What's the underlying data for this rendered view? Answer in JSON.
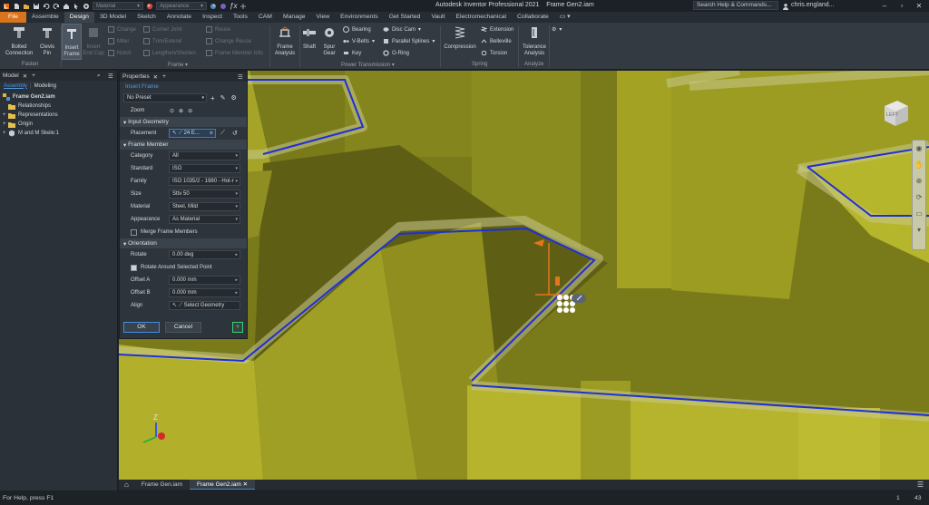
{
  "titlebar": {
    "material_placeholder": "Material",
    "appearance_placeholder": "Appearance",
    "app_title": "Autodesk Inventor Professional 2021",
    "doc_title": "Frame Gen2.iam",
    "search_placeholder": "Search Help & Commands...",
    "user": "chris.england..."
  },
  "menu": {
    "tabs": [
      "File",
      "Assemble",
      "Design",
      "3D Model",
      "Sketch",
      "Annotate",
      "Inspect",
      "Tools",
      "CAM",
      "Manage",
      "View",
      "Environments",
      "Get Started",
      "Vault",
      "Electromechanical",
      "Collaborate"
    ],
    "active": "Design"
  },
  "ribbon": {
    "fasten": {
      "bolted": "Bolted Connection",
      "bolted_1": "Bolted",
      "bolted_2": "Connection",
      "clevis_1": "Clevis",
      "clevis_2": "Pin",
      "label": "Fasten"
    },
    "frame": {
      "insert_1": "Insert",
      "insert_2": "Frame",
      "endcap_1": "Insert",
      "endcap_2": "End Cap",
      "change": "Change",
      "miter": "Miter",
      "notch": "Notch",
      "corner_joint": "Corner Joint",
      "trim_extend": "Trim/Extend",
      "lengthen": "Lengthen/Shorten",
      "reuse": "Reuse",
      "change_reuse": "Change Reuse",
      "member_info": "Frame Member Info",
      "label": "Frame"
    },
    "frame_analysis_1": "Frame",
    "frame_analysis_2": "Analysis",
    "power": {
      "shaft": "Shaft",
      "spur_1": "Spur",
      "spur_2": "Gear",
      "bearing": "Bearing",
      "vbelts": "V-Belts",
      "key": "Key",
      "disc_cam": "Disc Cam",
      "parallel_splines": "Parallel Splines",
      "oring": "O-Ring",
      "label": "Power Transmission"
    },
    "spring": {
      "compression": "Compression",
      "extension": "Extension",
      "belleville": "Belleville",
      "torsion": "Torsion",
      "label": "Spring"
    },
    "analyze": {
      "tol_1": "Tolerance",
      "tol_2": "Analysis",
      "label": "Analyze"
    }
  },
  "browser": {
    "title": "Model",
    "tab_assembly": "Assembly",
    "tab_modeling": "Modeling",
    "root": "Frame Gen2.iam",
    "items": [
      "Relationships",
      "Representations",
      "Origin",
      "M and M Skele:1"
    ]
  },
  "properties": {
    "title": "Properties",
    "command": "Insert Frame",
    "preset": "No Preset",
    "zoom_label": "Zoom",
    "input_geometry": "Input Geometry",
    "placement_label": "Placement",
    "placement_value": "24 E...",
    "frame_member": "Frame Member",
    "fields": [
      {
        "label": "Category",
        "value": "All"
      },
      {
        "label": "Standard",
        "value": "ISO"
      },
      {
        "label": "Family",
        "value": "ISO 1035/2 - 1980 - Hot-r"
      },
      {
        "label": "Size",
        "value": "Sttv 50"
      },
      {
        "label": "Material",
        "value": "Steel, Mild"
      },
      {
        "label": "Appearance",
        "value": "As Material"
      }
    ],
    "merge_label": "Merge Frame Members",
    "orientation": "Orientation",
    "rotate_label": "Rotate",
    "rotate_value": "0.00 deg",
    "rotate_around": "Rotate Around Selected Point",
    "offset_a_label": "Offset A",
    "offset_a_value": "0.000 mm",
    "offset_b_label": "Offset B",
    "offset_b_value": "0.000 mm",
    "align_label": "Align",
    "align_value": "Select Geometry",
    "ok": "OK",
    "cancel": "Cancel"
  },
  "viewcube": {
    "face": "LEFT"
  },
  "axes": {
    "z": "Z"
  },
  "doc_tabs": [
    "Frame Gen.iam",
    "Frame Gen2.iam"
  ],
  "status": {
    "help": "For Help, press F1",
    "count_a": "1",
    "count_b": "43"
  },
  "colors": {
    "accent_orange": "#d9731c",
    "frame_blue": "#1f2fd6",
    "model_yellow": "#b3b128"
  }
}
